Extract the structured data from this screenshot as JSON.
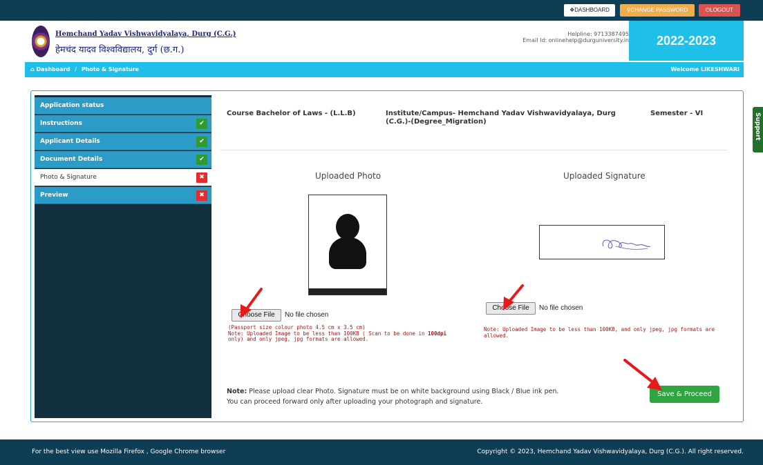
{
  "topnav": {
    "dashboard": "❖DASHBOARD",
    "change_password": "⚲CHANGE PASSWORD",
    "logout": "⏻LOGOUT"
  },
  "header": {
    "university_english": "Hemchand Yadav Vishwavidyalaya, Durg (C.G.)",
    "university_hindi": "हेमचंद यादव विश्वविद्यालय, दुर्ग (छ.ग.)",
    "helpline": "Helpline: 9713387495",
    "email": "Email Id: onlinehelp@durguniversity.in",
    "session": "2022-2023"
  },
  "breadcrumb": {
    "home": "⌂ Dashboard",
    "separator": "/",
    "current": "Photo & Signature",
    "welcome": "Welcome LIKESHWARI"
  },
  "sidebar": {
    "items": [
      {
        "label": "Application status",
        "status": ""
      },
      {
        "label": "Instructions",
        "status": "✔"
      },
      {
        "label": "Applicant Details",
        "status": "✔"
      },
      {
        "label": "Document Details",
        "status": "✔"
      },
      {
        "label": "Photo & Signature",
        "status": "✖"
      },
      {
        "label": "Preview",
        "status": "✖"
      }
    ]
  },
  "course": {
    "course": "Course Bachelor of Laws - (L.L.B)",
    "institute": "Institute/Campus- Hemchand Yadav Vishwavidyalaya, Durg (C.G.)-(Degree_Migration)",
    "semester": "Semester - VI"
  },
  "photo": {
    "title": "Uploaded Photo",
    "choose_label": "Choose File",
    "file_status": "No file chosen",
    "note_line1": "(Passport size colour photo 4.5 cm x 3.5 cm)",
    "note_line2": "Note: Uploaded Image to be less than 100KB ( Scan to be done in ",
    "note_dpi": "100dpi",
    "note_line3": "only) and only jpeg, jpg formats are allowed."
  },
  "signature": {
    "title": "Uploaded Signature",
    "choose_label": "Choose File",
    "file_status": "No file chosen",
    "note": "Note: Uploaded Image to be less than 100KB, and only jpeg, jpg formats are allowed."
  },
  "bottom": {
    "note_label": "Note:",
    "note_text": " Please upload clear Photo. Signature must be on white background using Black / Blue ink pen.",
    "note_line2": "You can proceed forward only after uploading your photograph and signature.",
    "save_button": "Save & Proceed"
  },
  "support": "Support",
  "footer": {
    "left": "For the best view use Mozilla Firefox , Google Chrome browser",
    "right": "Copyright © 2023, Hemchand Yadav Vishwavidyalaya, Durg (C.G.). All right reserved."
  },
  "colors": {
    "nav_dark": "#0e3e55",
    "accent_cyan": "#1ec0ea",
    "sidebar_blue": "#2a9cc7",
    "success_green": "#2fa43f",
    "danger_red": "#e52b2b",
    "annotation_arrow": "#e51b1b"
  }
}
